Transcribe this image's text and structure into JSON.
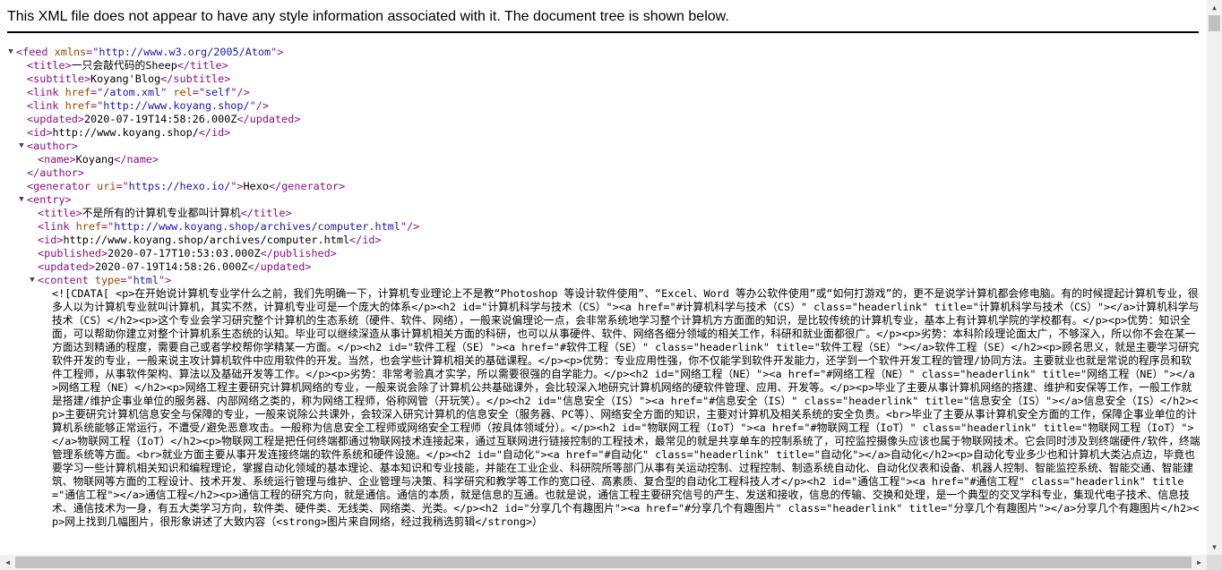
{
  "banner": "This XML file does not appear to have any style information associated with it. The document tree is shown below.",
  "scrollbar": {
    "up": "▲",
    "down": "▼",
    "left": "◀",
    "right": "▶"
  },
  "toggle": "▼",
  "lines": [
    {
      "indent": 0,
      "toggle": true,
      "parts": [
        [
          "b",
          "<"
        ],
        [
          "t",
          "feed"
        ],
        [
          "a",
          " xmlns"
        ],
        [
          "b",
          "=\""
        ],
        [
          "v",
          "http://www.w3.org/2005/Atom"
        ],
        [
          "b",
          "\">"
        ]
      ]
    },
    {
      "indent": 1,
      "parts": [
        [
          "b",
          "<"
        ],
        [
          "t",
          "title"
        ],
        [
          "b",
          ">"
        ],
        [
          "x",
          "一只会敲代码的Sheep"
        ],
        [
          "b",
          "</"
        ],
        [
          "t",
          "title"
        ],
        [
          "b",
          ">"
        ]
      ]
    },
    {
      "indent": 1,
      "parts": [
        [
          "b",
          "<"
        ],
        [
          "t",
          "subtitle"
        ],
        [
          "b",
          ">"
        ],
        [
          "x",
          "Koyang'Blog"
        ],
        [
          "b",
          "</"
        ],
        [
          "t",
          "subtitle"
        ],
        [
          "b",
          ">"
        ]
      ]
    },
    {
      "indent": 1,
      "parts": [
        [
          "b",
          "<"
        ],
        [
          "t",
          "link"
        ],
        [
          "a",
          " href"
        ],
        [
          "b",
          "=\""
        ],
        [
          "v",
          "/atom.xml"
        ],
        [
          "b",
          "\""
        ],
        [
          "a",
          " rel"
        ],
        [
          "b",
          "=\""
        ],
        [
          "v",
          "self"
        ],
        [
          "b",
          "\"/>"
        ]
      ]
    },
    {
      "indent": 1,
      "parts": [
        [
          "b",
          "<"
        ],
        [
          "t",
          "link"
        ],
        [
          "a",
          " href"
        ],
        [
          "b",
          "=\""
        ],
        [
          "v",
          "http://www.koyang.shop/"
        ],
        [
          "b",
          "\"/>"
        ]
      ]
    },
    {
      "indent": 1,
      "parts": [
        [
          "b",
          "<"
        ],
        [
          "t",
          "updated"
        ],
        [
          "b",
          ">"
        ],
        [
          "x",
          "2020-07-19T14:58:26.000Z"
        ],
        [
          "b",
          "</"
        ],
        [
          "t",
          "updated"
        ],
        [
          "b",
          ">"
        ]
      ]
    },
    {
      "indent": 1,
      "parts": [
        [
          "b",
          "<"
        ],
        [
          "t",
          "id"
        ],
        [
          "b",
          ">"
        ],
        [
          "x",
          "http://www.koyang.shop/"
        ],
        [
          "b",
          "</"
        ],
        [
          "t",
          "id"
        ],
        [
          "b",
          ">"
        ]
      ]
    },
    {
      "indent": 1,
      "toggle": true,
      "parts": [
        [
          "b",
          "<"
        ],
        [
          "t",
          "author"
        ],
        [
          "b",
          ">"
        ]
      ]
    },
    {
      "indent": 2,
      "parts": [
        [
          "b",
          "<"
        ],
        [
          "t",
          "name"
        ],
        [
          "b",
          ">"
        ],
        [
          "x",
          "Koyang"
        ],
        [
          "b",
          "</"
        ],
        [
          "t",
          "name"
        ],
        [
          "b",
          ">"
        ]
      ]
    },
    {
      "indent": 1,
      "parts": [
        [
          "b",
          "</"
        ],
        [
          "t",
          "author"
        ],
        [
          "b",
          ">"
        ]
      ]
    },
    {
      "indent": 1,
      "parts": [
        [
          "b",
          "<"
        ],
        [
          "t",
          "generator"
        ],
        [
          "a",
          " uri"
        ],
        [
          "b",
          "=\""
        ],
        [
          "v",
          "https://hexo.io/"
        ],
        [
          "b",
          "\">"
        ],
        [
          "x",
          "Hexo"
        ],
        [
          "b",
          "</"
        ],
        [
          "t",
          "generator"
        ],
        [
          "b",
          ">"
        ]
      ]
    },
    {
      "indent": 1,
      "toggle": true,
      "parts": [
        [
          "b",
          "<"
        ],
        [
          "t",
          "entry"
        ],
        [
          "b",
          ">"
        ]
      ]
    },
    {
      "indent": 2,
      "parts": [
        [
          "b",
          "<"
        ],
        [
          "t",
          "title"
        ],
        [
          "b",
          ">"
        ],
        [
          "x",
          "不是所有的计算机专业都叫计算机"
        ],
        [
          "b",
          "</"
        ],
        [
          "t",
          "title"
        ],
        [
          "b",
          ">"
        ]
      ]
    },
    {
      "indent": 2,
      "parts": [
        [
          "b",
          "<"
        ],
        [
          "t",
          "link"
        ],
        [
          "a",
          " href"
        ],
        [
          "b",
          "=\""
        ],
        [
          "v",
          "http://www.koyang.shop/archives/computer.html"
        ],
        [
          "b",
          "\"/>"
        ]
      ]
    },
    {
      "indent": 2,
      "parts": [
        [
          "b",
          "<"
        ],
        [
          "t",
          "id"
        ],
        [
          "b",
          ">"
        ],
        [
          "x",
          "http://www.koyang.shop/archives/computer.html"
        ],
        [
          "b",
          "</"
        ],
        [
          "t",
          "id"
        ],
        [
          "b",
          ">"
        ]
      ]
    },
    {
      "indent": 2,
      "parts": [
        [
          "b",
          "<"
        ],
        [
          "t",
          "published"
        ],
        [
          "b",
          ">"
        ],
        [
          "x",
          "2020-07-17T10:53:03.000Z"
        ],
        [
          "b",
          "</"
        ],
        [
          "t",
          "published"
        ],
        [
          "b",
          ">"
        ]
      ]
    },
    {
      "indent": 2,
      "parts": [
        [
          "b",
          "<"
        ],
        [
          "t",
          "updated"
        ],
        [
          "b",
          ">"
        ],
        [
          "x",
          "2020-07-19T14:58:26.000Z"
        ],
        [
          "b",
          "</"
        ],
        [
          "t",
          "updated"
        ],
        [
          "b",
          ">"
        ]
      ]
    },
    {
      "indent": 2,
      "toggle": true,
      "parts": [
        [
          "b",
          "<"
        ],
        [
          "t",
          "content"
        ],
        [
          "a",
          " type"
        ],
        [
          "b",
          "=\""
        ],
        [
          "v",
          "html"
        ],
        [
          "b",
          "\">"
        ]
      ]
    }
  ],
  "content_cdata": "<![CDATA[ <p>在开始说计算机专业学什么之前，我们先明确一下，计算机专业理论上不是教“Photoshop 等设计软件使用”、“Excel、Word 等办公软件使用”或“如何打游戏”的，更不是说学计算机都会修电脑。有的时候提起计算机专业，很多人以为计算机专业就叫计算机，其实不然，计算机专业可是一个庞大的体系</p><h2 id=\"计算机科学与技术（CS）\"><a href=\"#计算机科学与技术（CS）\" class=\"headerlink\" title=\"计算机科学与技术（CS）\"></a>计算机科学与技术（CS）</h2><p>这个专业会学习研究整个计算机的生态系统（硬件、软件、网络），一般来说偏理论一点，会非常系统地学习整个计算机方方面面的知识，是比较传统的计算机专业，基本上有计算机学院的学校都有。</p><p>优势：知识全面，可以帮助你建立对整个计算机系生态统的认知。毕业可以继续深造从事计算机相关方面的科研，也可以从事硬件、软件、网络各细分领域的相关工作，科研和就业面都很广。</p><p>劣势：本科阶段理论面太广，不够深入，所以你不会在某一方面达到精通的程度，需要自己或者学校帮你学精某一方面。</p><h2 id=\"软件工程（SE）\"><a href=\"#软件工程（SE）\" class=\"headerlink\" title=\"软件工程（SE）\"></a>软件工程（SE）</h2><p>顾名思义，就是主要学习研究软件开发的专业，一般来说主攻计算机软件中应用软件的开发。当然，也会学些计算机相关的基础课程。</p><p>优势：专业应用性强，你不仅能学到软件开发能力，还学到一个软件开发工程的管理/协同方法。主要就业也就是常说的程序员和软件工程师，从事软件架构、算法以及基础开发等工作。</p><p>劣势：非常考验真才实学，所以需要很强的自学能力。</p><h2 id=\"网络工程（NE）\"><a href=\"#网络工程（NE）\" class=\"headerlink\" title=\"网络工程（NE）\"></a>网络工程（NE）</h2><p>网络工程主要研究计算机网络的专业，一般来说会除了计算机公共基础课外，会比较深入地研究计算机网络的硬软件管理、应用、开发等。</p><p>毕业了主要从事计算机网络的搭建、维护和安保等工作，一般工作就是搭建/维护企事业单位的服务器、内部网络之类的，称为网络工程师，俗称网管（开玩笑）。</p><h2 id=\"信息安全（IS）\"><a href=\"#信息安全（IS）\" class=\"headerlink\" title=\"信息安全（IS）\"></a>信息安全（IS）</h2><p>主要研究计算机信息安全与保障的专业，一般来说除公共课外，会较深入研究计算机的信息安全（服务器、PC等）、网络安全方面的知识，主要对计算机及相关系统的安全负责。<br>毕业了主要从事计算机安全方面的工作，保障企事业单位的计算机系统能够正常运行，不遭受/避免恶意攻击。一般称为信息安全工程师或网络安全工程师（按具体领域分）。</p><h2 id=\"物联网工程（IoT）\"><a href=\"#物联网工程（IoT）\" class=\"headerlink\" title=\"物联网工程（IoT）\"></a>物联网工程（IoT）</h2><p>物联网工程是把任何终端都通过物联网技术连接起来，通过互联网进行链接控制的工程技术，最常见的就是共享单车的控制系统了，可控监控摄像头应该也属于物联网技术。它会同时涉及到终端硬件/软件，终端管理系统等方面。<br>就业方面主要从事开发连接终端的软件系统和硬件设施。</p><h2 id=\"自动化\"><a href=\"#自动化\" class=\"headerlink\" title=\"自动化\"></a>自动化</h2><p>自动化专业多少也和计算机大类沾点边，毕竟也要学习一些计算机相关知识和编程理论，掌握自动化领域的基本理论、基本知识和专业技能，并能在工业企业、科研院所等部门从事有关运动控制、过程控制、制造系统自动化、自动化仪表和设备、机器人控制、智能监控系统、智能交通、智能建筑、物联网等方面的工程设计、技术开发、系统运行管理与维护、企业管理与决策、科学研究和教学等工作的宽口径、高素质、复合型的自动化工程科技人才</p><h2 id=\"通信工程\"><a href=\"#通信工程\" class=\"headerlink\" title=\"通信工程\"></a>通信工程</h2><p>通信工程的研究方向，就是通信。通信的本质，就是信息的互通。也就是说，通信工程主要研究信号的产生、发送和接收，信息的传输、交换和处理，是一个典型的交叉学科专业，集现代电子技术、信息技术、通信技术为一身，有五大类学习方向，软件类、硬件类、无线类、网络类、光类。</p><h2 id=\"分享几个有趣图片\"><a href=\"#分享几个有趣图片\" class=\"headerlink\" title=\"分享几个有趣图片\"></a>分享几个有趣图片</h2><p>网上找到几幅图片，很形象讲述了大致内容（<strong>图片来自网络，经过我稍选剪辑</strong>）"
}
